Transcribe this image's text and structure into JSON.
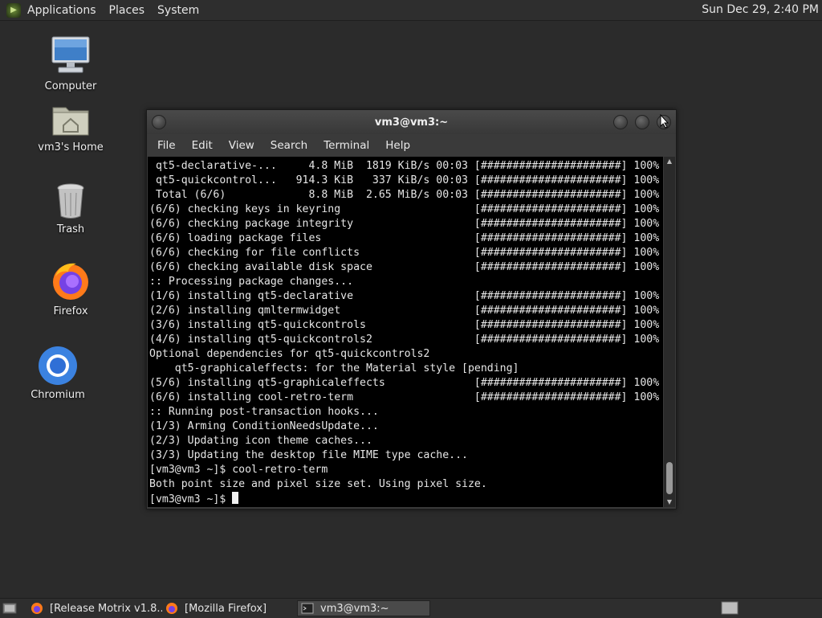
{
  "top_panel": {
    "menus": [
      "Applications",
      "Places",
      "System"
    ],
    "clock": "Sun Dec 29,  2:40 PM"
  },
  "desktop": {
    "icons": [
      {
        "label": "Computer",
        "icon": "computer-icon"
      },
      {
        "label": "vm3's Home",
        "icon": "home-folder-icon"
      },
      {
        "label": "Trash",
        "icon": "trash-icon"
      },
      {
        "label": "Firefox",
        "icon": "firefox-icon"
      },
      {
        "label": "Chromium",
        "icon": "chromium-icon"
      }
    ]
  },
  "terminal": {
    "title": "vm3@vm3:~",
    "menu": [
      "File",
      "Edit",
      "View",
      "Search",
      "Terminal",
      "Help"
    ],
    "lines": [
      " qt5-declarative-...     4.8 MiB  1819 KiB/s 00:03 [######################] 100%",
      " qt5-quickcontrol...   914.3 KiB   337 KiB/s 00:03 [######################] 100%",
      " Total (6/6)             8.8 MiB  2.65 MiB/s 00:03 [######################] 100%",
      "(6/6) checking keys in keyring                     [######################] 100%",
      "(6/6) checking package integrity                   [######################] 100%",
      "(6/6) loading package files                        [######################] 100%",
      "(6/6) checking for file conflicts                  [######################] 100%",
      "(6/6) checking available disk space                [######################] 100%",
      ":: Processing package changes...",
      "(1/6) installing qt5-declarative                   [######################] 100%",
      "(2/6) installing qmltermwidget                     [######################] 100%",
      "(3/6) installing qt5-quickcontrols                 [######################] 100%",
      "(4/6) installing qt5-quickcontrols2                [######################] 100%",
      "Optional dependencies for qt5-quickcontrols2",
      "    qt5-graphicaleffects: for the Material style [pending]",
      "(5/6) installing qt5-graphicaleffects              [######################] 100%",
      "(6/6) installing cool-retro-term                   [######################] 100%",
      ":: Running post-transaction hooks...",
      "(1/3) Arming ConditionNeedsUpdate...",
      "(2/3) Updating icon theme caches...",
      "(3/3) Updating the desktop file MIME type cache...",
      "[vm3@vm3 ~]$ cool-retro-term",
      "Both point size and pixel size set. Using pixel size."
    ],
    "prompt": "[vm3@vm3 ~]$ "
  },
  "taskbar": {
    "tasks": [
      {
        "label": "[Release Motrix v1.8....",
        "icon": "firefox-icon"
      },
      {
        "label": "[Mozilla Firefox]",
        "icon": "firefox-icon"
      },
      {
        "label": "vm3@vm3:~",
        "icon": "terminal-icon"
      }
    ]
  },
  "colors": {
    "desktop_bg": "#2b2b2b",
    "panel_bg": "#2e2e2e",
    "terminal_bg": "#000000",
    "terminal_fg": "#e6e6e6"
  }
}
